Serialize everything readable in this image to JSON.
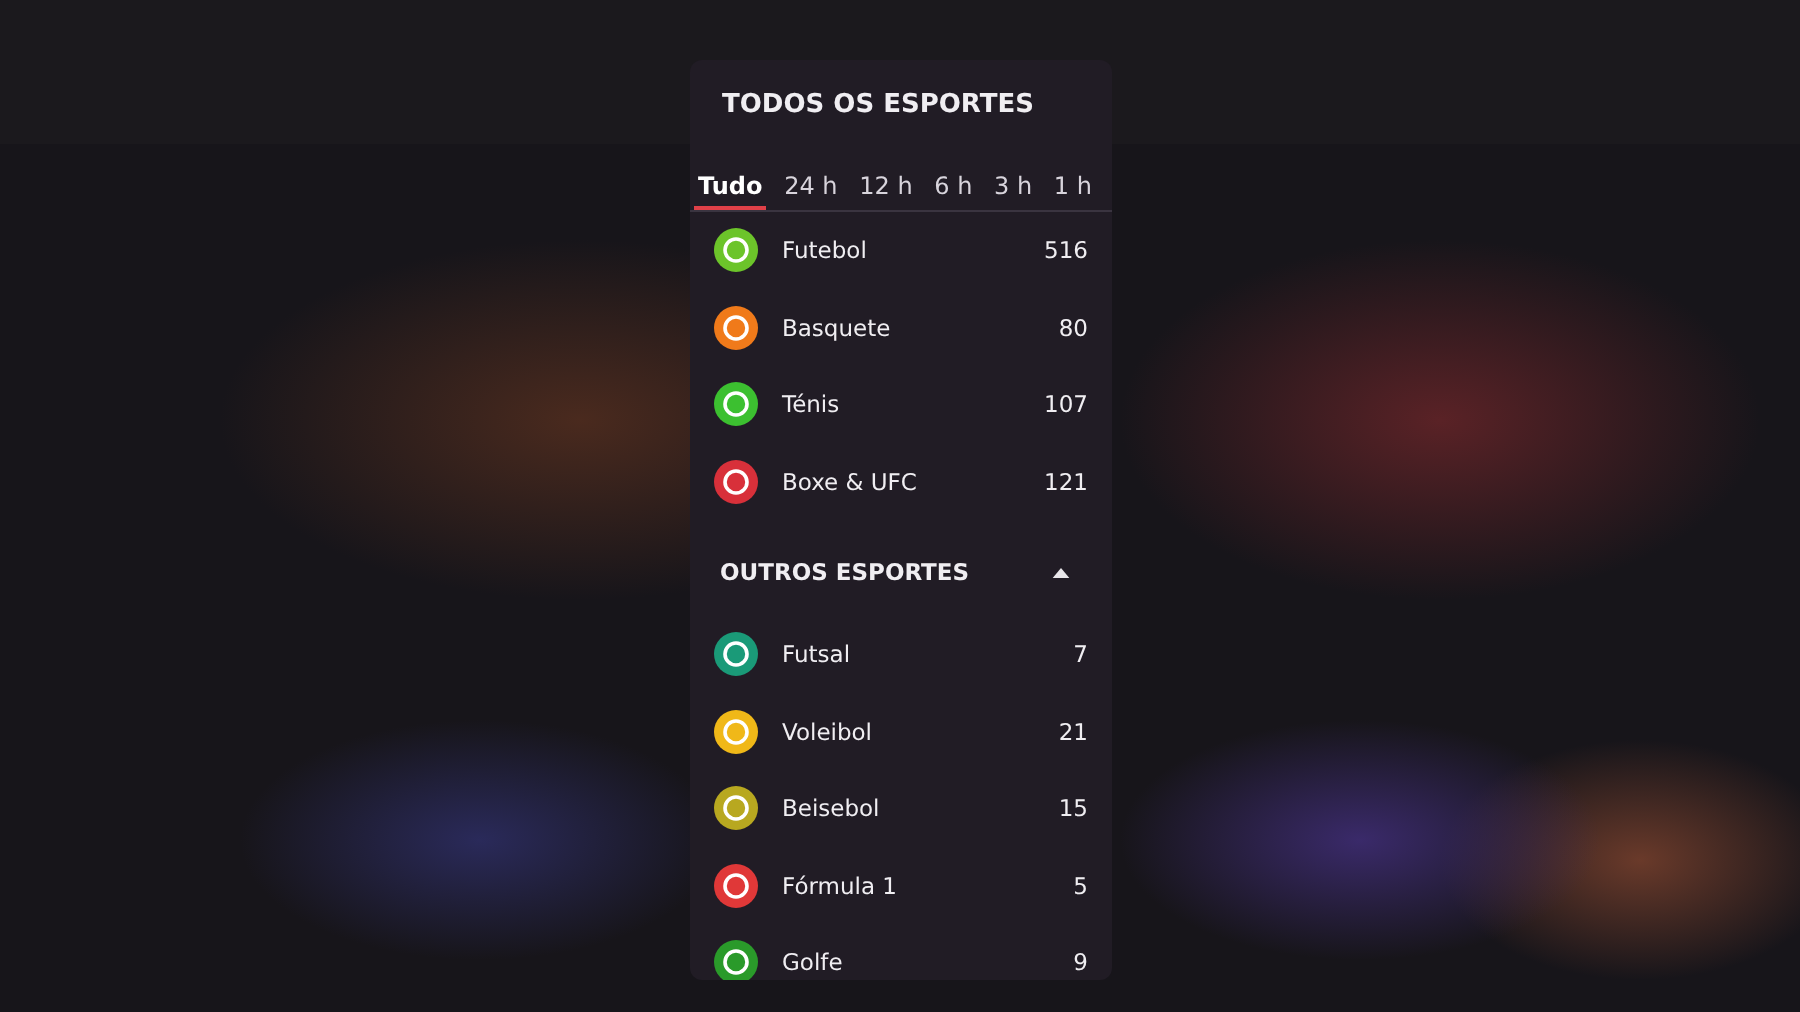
{
  "panel": {
    "title": "TODOS OS ESPORTES",
    "tabs": [
      {
        "label": "Tudo",
        "selected": true
      },
      {
        "label": "24 h",
        "selected": false
      },
      {
        "label": "12 h",
        "selected": false
      },
      {
        "label": "6 h",
        "selected": false
      },
      {
        "label": "3 h",
        "selected": false
      },
      {
        "label": "1 h",
        "selected": false
      }
    ],
    "sports": [
      {
        "name": "Futebol",
        "count": "516",
        "color": "#6cc42a"
      },
      {
        "name": "Basquete",
        "count": "80",
        "color": "#f07a1a"
      },
      {
        "name": "Ténis",
        "count": "107",
        "color": "#3cc030"
      },
      {
        "name": "Boxe & UFC",
        "count": "121",
        "color": "#d8303a"
      }
    ],
    "other_section": {
      "title": "OUTROS ESPORTES",
      "expanded": true,
      "sports": [
        {
          "name": "Futsal",
          "count": "7",
          "color": "#1a9a78"
        },
        {
          "name": "Voleibol",
          "count": "21",
          "color": "#f0b818"
        },
        {
          "name": "Beisebol",
          "count": "15",
          "color": "#b8a820"
        },
        {
          "name": "Fórmula 1",
          "count": "5",
          "color": "#e03838"
        },
        {
          "name": "Golfe",
          "count": "9",
          "color": "#2a9a2a"
        }
      ]
    }
  }
}
